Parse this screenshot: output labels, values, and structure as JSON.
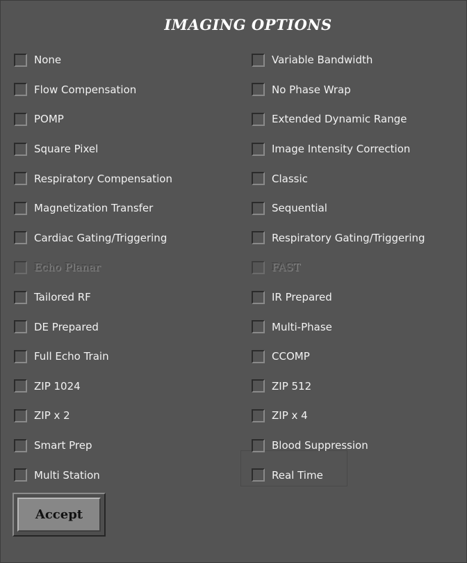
{
  "dialog": {
    "title": "IMAGING OPTIONS",
    "accept_label": "Accept"
  },
  "options": {
    "left": [
      {
        "label": "None",
        "checked": false,
        "enabled": true
      },
      {
        "label": "Flow Compensation",
        "checked": false,
        "enabled": true
      },
      {
        "label": "POMP",
        "checked": false,
        "enabled": true
      },
      {
        "label": "Square Pixel",
        "checked": false,
        "enabled": true
      },
      {
        "label": "Respiratory Compensation",
        "checked": false,
        "enabled": true
      },
      {
        "label": "Magnetization Transfer",
        "checked": false,
        "enabled": true
      },
      {
        "label": "Cardiac Gating/Triggering",
        "checked": false,
        "enabled": true
      },
      {
        "label": "Echo Planar",
        "checked": false,
        "enabled": false
      },
      {
        "label": "Tailored RF",
        "checked": false,
        "enabled": true
      },
      {
        "label": "DE Prepared",
        "checked": false,
        "enabled": true
      },
      {
        "label": "Full Echo Train",
        "checked": false,
        "enabled": true
      },
      {
        "label": "ZIP 1024",
        "checked": false,
        "enabled": true
      },
      {
        "label": "ZIP x 2",
        "checked": false,
        "enabled": true
      },
      {
        "label": "Smart Prep",
        "checked": false,
        "enabled": true
      },
      {
        "label": "Multi Station",
        "checked": false,
        "enabled": true
      }
    ],
    "right": [
      {
        "label": "Variable Bandwidth",
        "checked": false,
        "enabled": true
      },
      {
        "label": "No Phase Wrap",
        "checked": false,
        "enabled": true
      },
      {
        "label": "Extended Dynamic Range",
        "checked": false,
        "enabled": true
      },
      {
        "label": "Image Intensity Correction",
        "checked": false,
        "enabled": true
      },
      {
        "label": "Classic",
        "checked": false,
        "enabled": true
      },
      {
        "label": "Sequential",
        "checked": false,
        "enabled": true
      },
      {
        "label": "Respiratory Gating/Triggering",
        "checked": false,
        "enabled": true
      },
      {
        "label": "FAST",
        "checked": false,
        "enabled": false
      },
      {
        "label": "IR Prepared",
        "checked": false,
        "enabled": true
      },
      {
        "label": "Multi-Phase",
        "checked": false,
        "enabled": true
      },
      {
        "label": "CCOMP",
        "checked": false,
        "enabled": true
      },
      {
        "label": "ZIP 512",
        "checked": false,
        "enabled": true
      },
      {
        "label": "ZIP x 4",
        "checked": false,
        "enabled": true
      },
      {
        "label": "Blood Suppression",
        "checked": false,
        "enabled": true
      },
      {
        "label": "Real Time",
        "checked": false,
        "enabled": true
      }
    ]
  },
  "colors": {
    "panel_background": "#545454",
    "label_text": "#f2f2f2",
    "disabled_text": "#5a5a5a",
    "button_face": "#878787"
  }
}
